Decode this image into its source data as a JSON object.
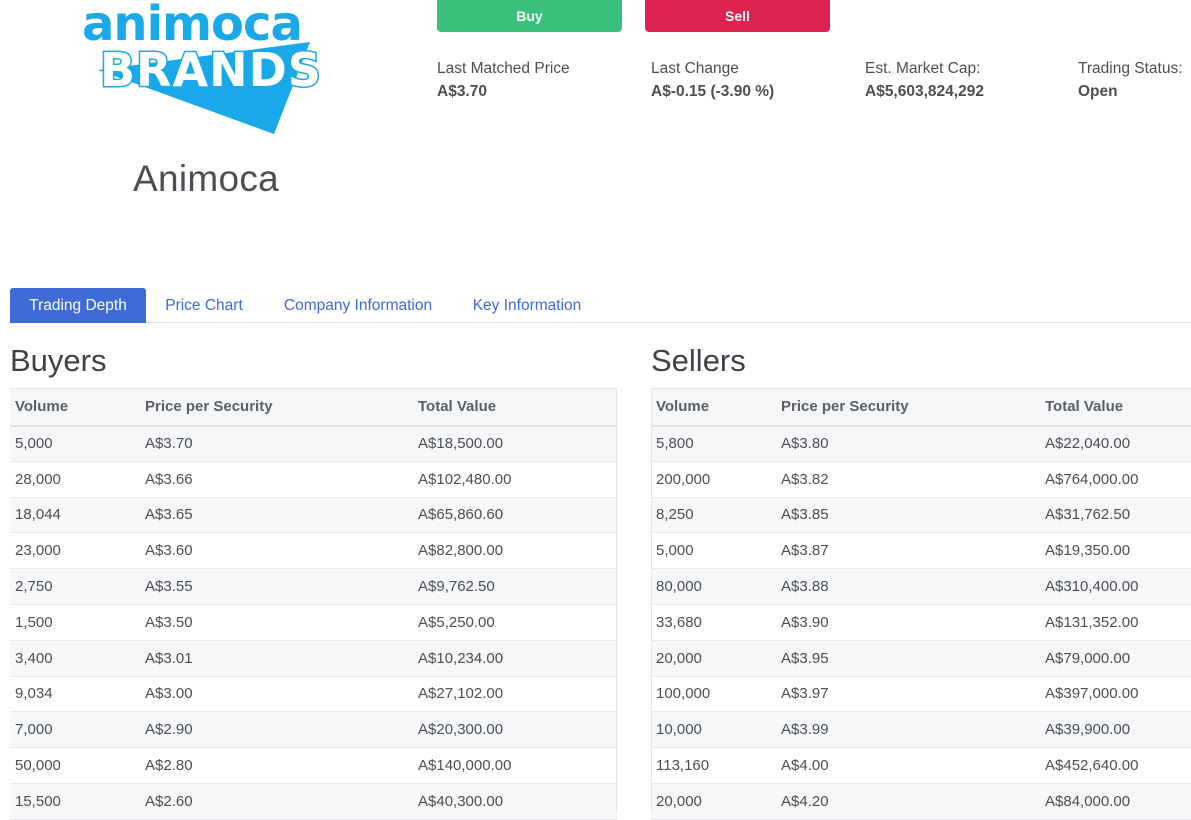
{
  "company": {
    "logo_line1": "animoca",
    "logo_line2": "BRANDS",
    "name": "Animoca"
  },
  "actions": {
    "buy_label": "Buy",
    "sell_label": "Sell",
    "buy_color": "#3ac07a",
    "sell_color": "#e02250"
  },
  "stats": [
    {
      "label": "Last Matched Price",
      "value": "A$3.70"
    },
    {
      "label": "Last Change",
      "value": "A$-0.15 (-3.90 %)"
    },
    {
      "label": "Est. Market Cap:",
      "value": "A$5,603,824,292"
    },
    {
      "label": "Trading Status:",
      "value": "Open"
    }
  ],
  "tabs": [
    {
      "label": "Trading Depth",
      "active": true
    },
    {
      "label": "Price Chart",
      "active": false
    },
    {
      "label": "Company Information",
      "active": false
    },
    {
      "label": "Key Information",
      "active": false
    }
  ],
  "buyers": {
    "title": "Buyers",
    "columns": [
      "Volume",
      "Price per Security",
      "Total Value"
    ],
    "rows": [
      [
        "5,000",
        "A$3.70",
        "A$18,500.00"
      ],
      [
        "28,000",
        "A$3.66",
        "A$102,480.00"
      ],
      [
        "18,044",
        "A$3.65",
        "A$65,860.60"
      ],
      [
        "23,000",
        "A$3.60",
        "A$82,800.00"
      ],
      [
        "2,750",
        "A$3.55",
        "A$9,762.50"
      ],
      [
        "1,500",
        "A$3.50",
        "A$5,250.00"
      ],
      [
        "3,400",
        "A$3.01",
        "A$10,234.00"
      ],
      [
        "9,034",
        "A$3.00",
        "A$27,102.00"
      ],
      [
        "7,000",
        "A$2.90",
        "A$20,300.00"
      ],
      [
        "50,000",
        "A$2.80",
        "A$140,000.00"
      ],
      [
        "15,500",
        "A$2.60",
        "A$40,300.00"
      ]
    ]
  },
  "sellers": {
    "title": "Sellers",
    "columns": [
      "Volume",
      "Price per Security",
      "Total Value"
    ],
    "rows": [
      [
        "5,800",
        "A$3.80",
        "A$22,040.00"
      ],
      [
        "200,000",
        "A$3.82",
        "A$764,000.00"
      ],
      [
        "8,250",
        "A$3.85",
        "A$31,762.50"
      ],
      [
        "5,000",
        "A$3.87",
        "A$19,350.00"
      ],
      [
        "80,000",
        "A$3.88",
        "A$310,400.00"
      ],
      [
        "33,680",
        "A$3.90",
        "A$131,352.00"
      ],
      [
        "20,000",
        "A$3.95",
        "A$79,000.00"
      ],
      [
        "100,000",
        "A$3.97",
        "A$397,000.00"
      ],
      [
        "10,000",
        "A$3.99",
        "A$39,900.00"
      ],
      [
        "113,160",
        "A$4.00",
        "A$452,640.00"
      ],
      [
        "20,000",
        "A$4.20",
        "A$84,000.00"
      ]
    ]
  }
}
